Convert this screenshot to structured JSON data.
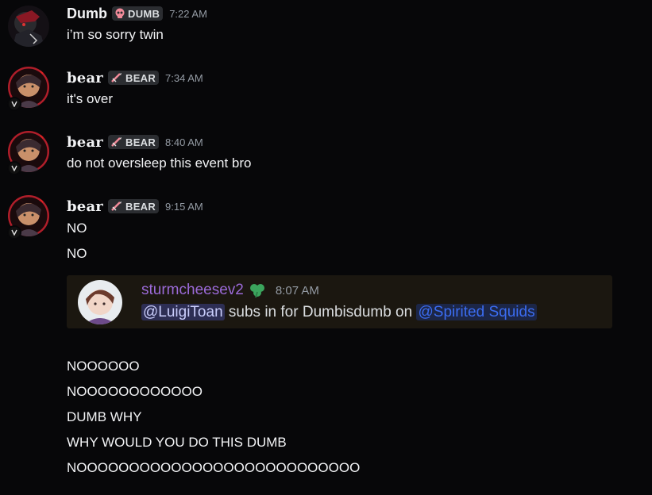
{
  "messages": [
    {
      "author": "Dumb",
      "tag": "DUMB",
      "tag_icon": "skull-icon",
      "time": "7:22 AM",
      "lines": [
        "i’m so sorry twin"
      ]
    },
    {
      "author": "bear",
      "tag": "BEAR",
      "tag_icon": "sword-icon",
      "time": "7:34 AM",
      "lines": [
        "it's over"
      ]
    },
    {
      "author": "bear",
      "tag": "BEAR",
      "tag_icon": "sword-icon",
      "time": "8:40 AM",
      "lines": [
        "do not oversleep this event bro"
      ]
    },
    {
      "author": "bear",
      "tag": "BEAR",
      "tag_icon": "sword-icon",
      "time": "9:15 AM",
      "lines": [
        "NO",
        "NO"
      ]
    }
  ],
  "embed": {
    "author": "sturmcheesev2",
    "badge_icon": "clover-icon",
    "time": "8:07 AM",
    "mention_user": "@LuigiToan",
    "text_middle": " subs in for Dumbisdumb on ",
    "mention_role": "@Spirited Squids"
  },
  "followup_lines": [
    "NOOOOOO",
    "NOOOOOOOOOOOO",
    "DUMB WHY",
    "WHY WOULD YOU DO THIS DUMB",
    "NOOOOOOOOOOOOOOOOOOOOOOOOOOO"
  ],
  "colors": {
    "background": "#070709",
    "embed_name": "#9b6ad8",
    "role_mention": "#3b6cf0"
  }
}
